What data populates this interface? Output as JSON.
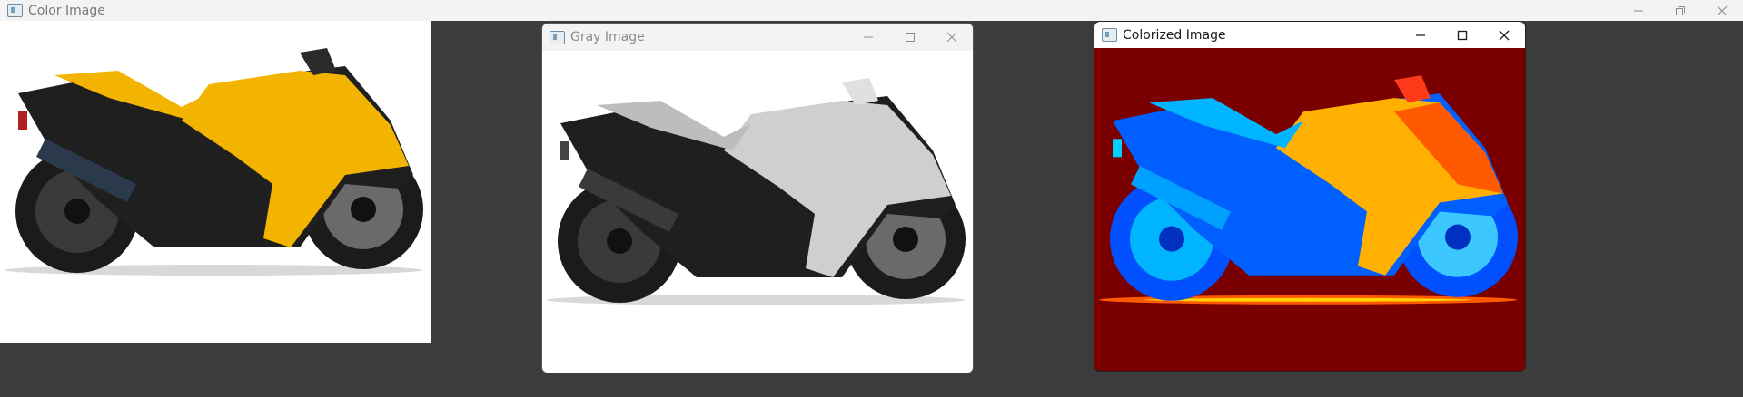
{
  "windows": {
    "color": {
      "title": "Color Image",
      "icon": "app-window-icon"
    },
    "gray": {
      "title": "Gray Image",
      "icon": "app-window-icon"
    },
    "colorized": {
      "title": "Colorized Image",
      "icon": "app-window-icon"
    }
  },
  "window_controls": {
    "minimize": "minimize-icon",
    "maximize": "maximize-icon",
    "restore": "restore-icon",
    "close": "close-icon"
  },
  "images": {
    "color": {
      "subject": "motorcycle",
      "palette": [
        "#f2b400",
        "#1e1e1e",
        "#ffffff"
      ]
    },
    "gray": {
      "subject": "motorcycle",
      "palette": [
        "#cfcfcf",
        "#222222",
        "#ffffff"
      ]
    },
    "colorized": {
      "subject": "motorcycle",
      "palette": [
        "#7a0000",
        "#0050ff",
        "#00b4ff",
        "#ffd200",
        "#ff5a00"
      ]
    }
  },
  "desktop_background": "#3c3c3c"
}
